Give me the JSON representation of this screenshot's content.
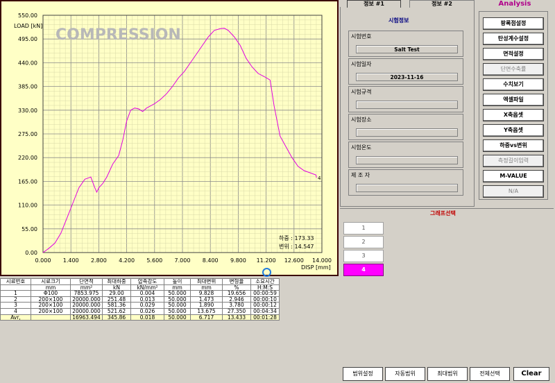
{
  "chart": {
    "overlay_title": "COMPRESSION",
    "y_axis_label": "LOAD [kN]",
    "x_axis_label": "DISP [mm]",
    "y_ticks": [
      "550.00",
      "495.00",
      "440.00",
      "385.00",
      "330.00",
      "275.00",
      "220.00",
      "165.00",
      "110.00",
      "55.00",
      "0.00"
    ],
    "x_ticks": [
      "0.000",
      "1.400",
      "2.800",
      "4.200",
      "5.600",
      "7.000",
      "8.400",
      "9.800",
      "11.200",
      "12.600",
      "14.000"
    ],
    "readout_load": "하중 : 173.33",
    "readout_disp": "변위 : 14.547",
    "series_marker": "4",
    "line_color": "#e000e0"
  },
  "chart_data": {
    "type": "line",
    "xlabel": "DISP [mm]",
    "ylabel": "LOAD [kN]",
    "xlim": [
      0,
      14
    ],
    "ylim": [
      0,
      550
    ],
    "grid": true,
    "series": [
      {
        "name": "4",
        "x": [
          0.0,
          0.3,
          0.6,
          0.9,
          1.2,
          1.5,
          1.8,
          2.1,
          2.4,
          2.6,
          2.7,
          2.8,
          3.0,
          3.2,
          3.5,
          3.8,
          4.0,
          4.2,
          4.4,
          4.6,
          4.8,
          5.0,
          5.2,
          5.4,
          5.6,
          5.9,
          6.2,
          6.5,
          6.8,
          7.1,
          7.4,
          7.7,
          8.0,
          8.3,
          8.6,
          8.9,
          9.1,
          9.3,
          9.6,
          9.9,
          10.2,
          10.5,
          10.8,
          11.1,
          11.4,
          11.6,
          11.9,
          12.2,
          12.5,
          12.8,
          13.1,
          13.4,
          13.7,
          14.0,
          14.3,
          14.547
        ],
        "values": [
          0,
          10,
          22,
          45,
          80,
          115,
          150,
          170,
          175,
          150,
          140,
          150,
          160,
          175,
          205,
          225,
          260,
          305,
          330,
          335,
          333,
          327,
          335,
          340,
          345,
          355,
          368,
          385,
          405,
          420,
          440,
          460,
          480,
          500,
          515,
          519,
          520,
          515,
          500,
          480,
          450,
          430,
          415,
          408,
          400,
          340,
          270,
          245,
          220,
          200,
          190,
          185,
          180,
          176,
          174,
          173.33
        ]
      }
    ]
  },
  "tabs": [
    {
      "label": "정보 #1"
    },
    {
      "label": "정보 #2"
    }
  ],
  "analysis_label": "Analysis",
  "info": {
    "header": "시험정보",
    "fields": [
      {
        "label": "시험번호",
        "value": "Salt Test"
      },
      {
        "label": "시험일자",
        "value": "2023-11-16"
      },
      {
        "label": "시험규격",
        "value": ""
      },
      {
        "label": "시험장소",
        "value": ""
      },
      {
        "label": "시험온도",
        "value": ""
      },
      {
        "label": "제 조 자",
        "value": ""
      }
    ]
  },
  "analysis_buttons": [
    {
      "label": "팡록점설정",
      "disabled": false
    },
    {
      "label": "탄성계수설정",
      "disabled": false
    },
    {
      "label": "면적설정",
      "disabled": false
    },
    {
      "label": "단면수축률",
      "disabled": true
    },
    {
      "label": "수치보기",
      "disabled": false
    },
    {
      "label": "엑셀파일",
      "disabled": false
    },
    {
      "label": "X축옵셋",
      "disabled": false
    },
    {
      "label": "Y축옵셋",
      "disabled": false
    },
    {
      "label": "하중vs변위",
      "disabled": false
    },
    {
      "label": "측정길이입력",
      "disabled": true
    },
    {
      "label": "M-VALUE",
      "disabled": false
    },
    {
      "label": "N/A",
      "disabled": true
    }
  ],
  "graph_select": {
    "title": "그래프선택",
    "buttons": [
      "1",
      "2",
      "3",
      "4"
    ],
    "active": "4"
  },
  "bottom_buttons": [
    "범위설정",
    "자동범위",
    "최대범위",
    "전체선택",
    "Clear"
  ],
  "table": {
    "headers": [
      "시료번호",
      "시료크기",
      "단면적",
      "최대하중",
      "압축강도",
      "높이",
      "최대변위",
      "변형율",
      "소요시간"
    ],
    "units": [
      "",
      "mm",
      "mm²",
      "kN",
      "kN/mm²",
      "mm",
      "mm",
      "%",
      "H:M:S"
    ],
    "rows": [
      [
        "1",
        "Φ100",
        "7853.975",
        "29.00",
        "0.004",
        "50.000",
        "9.828",
        "19.656",
        "00:00:59"
      ],
      [
        "2",
        "200×100",
        "20000.000",
        "251.48",
        "0.013",
        "50.000",
        "1.473",
        "2.946",
        "00:00:10"
      ],
      [
        "3",
        "200×100",
        "20000.000",
        "581.36",
        "0.029",
        "50.000",
        "1.890",
        "3.780",
        "00:00:12"
      ],
      [
        "4",
        "200×100",
        "20000.000",
        "521.62",
        "0.026",
        "50.000",
        "13.675",
        "27.350",
        "00:04:34"
      ]
    ],
    "average": [
      "Avr,",
      "",
      "16963.494",
      "345.86",
      "0.018",
      "50.000",
      "6.717",
      "13.433",
      "00:01:28"
    ]
  }
}
